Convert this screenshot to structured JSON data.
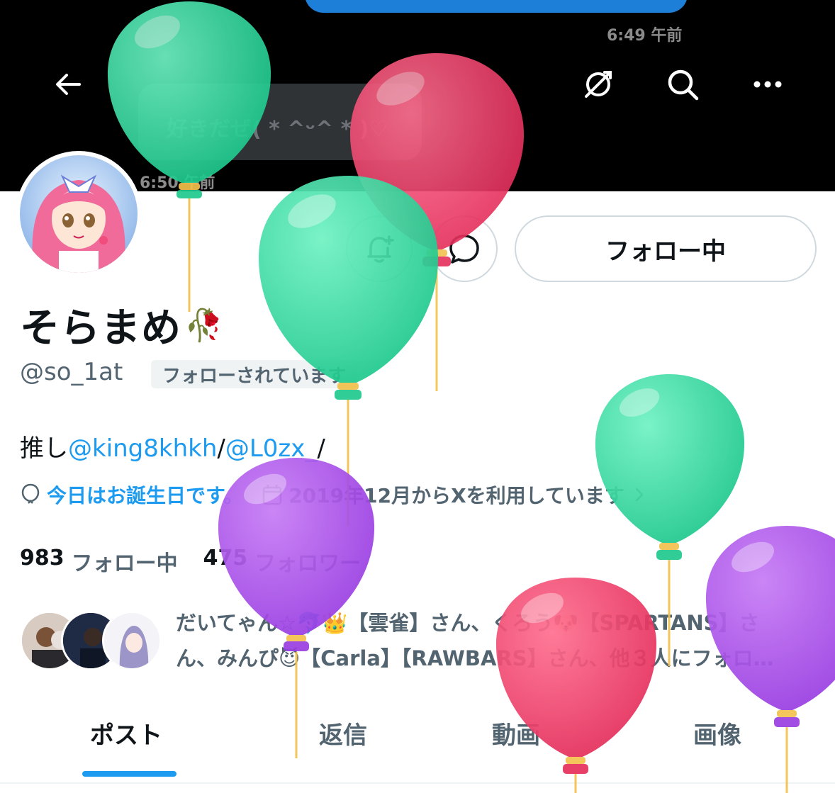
{
  "header": {
    "bubble_top_time": "6:49 午前",
    "bubble_text": "好きだぜ( * ^ᵕ^ * )♡",
    "bubble_bottom_time": "6:50 午前",
    "icons": [
      "back-arrow-icon",
      "no-follow-icon",
      "search-icon",
      "more-icon"
    ]
  },
  "actions": {
    "follow_label": "フォロー中",
    "icons": [
      "notification-bell-icon",
      "message-bubble-icon"
    ]
  },
  "profile": {
    "display_name": "そらまめ",
    "display_name_emoji": "🥀",
    "handle": "@so_1at",
    "follows_you_badge": "フォローされています",
    "bio_prefix": "推し",
    "bio_mention_1": "@king8khkh",
    "bio_sep_1": "/",
    "bio_mention_2": "@L0zx_",
    "bio_sep_2": "/",
    "birthday_text": "今日はお誕生日です。",
    "joined_text": "2019年12月からXを利用しています",
    "following_count": "983",
    "following_label": "フォロー中",
    "followers_count": "475",
    "followers_label": "フォロワー",
    "followers_you_know": "だいてゃん☆🐬👑【雲雀】さん、くろう🐶【SPARTANS】さん、みんぴ😈【Carla】【RAWBARS】さん、他３人にフォロ…"
  },
  "tabs": [
    {
      "label": "ポスト",
      "active": true
    },
    {
      "label": "返信",
      "active": false
    },
    {
      "label": "動画",
      "active": false
    },
    {
      "label": "画像",
      "active": false
    }
  ],
  "colors": {
    "accent": "#1d9bf0",
    "balloon_green": "#33d6a0",
    "balloon_red": "#ee3e6a",
    "balloon_purple": "#a94ce6"
  }
}
